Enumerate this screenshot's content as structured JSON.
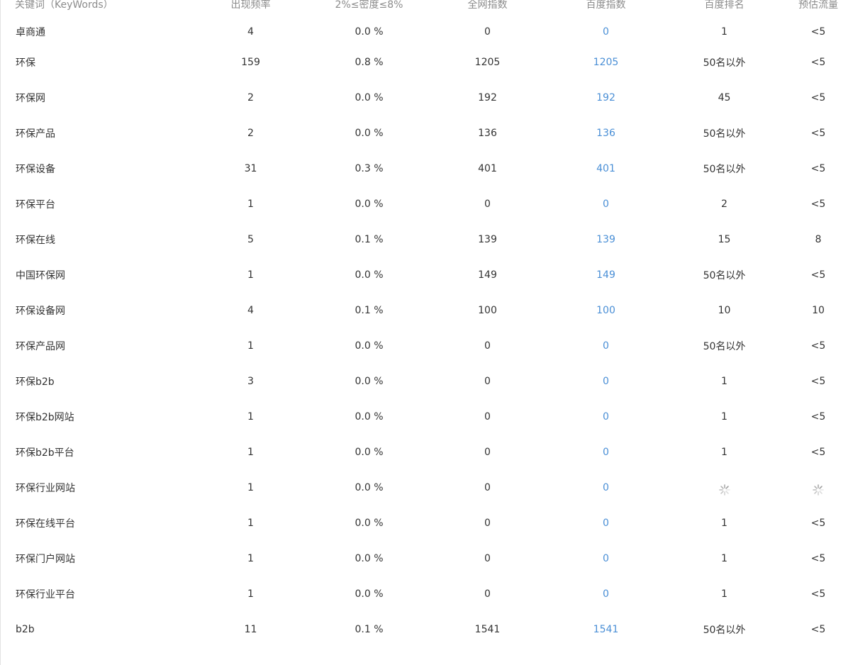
{
  "table": {
    "headers": {
      "keyword": "关键词（KeyWords）",
      "frequency": "出现频率",
      "density": "2%≤密度≤8%",
      "net_index": "全网指数",
      "baidu_index": "百度指数",
      "baidu_rank": "百度排名",
      "traffic": "预估流量"
    },
    "rows": [
      {
        "keyword": "卓商通",
        "frequency": "4",
        "density": "0.0 %",
        "net_index": "0",
        "baidu_index": "0",
        "baidu_rank": "1",
        "traffic": "<5"
      },
      {
        "keyword": "环保",
        "frequency": "159",
        "density": "0.8 %",
        "net_index": "1205",
        "baidu_index": "1205",
        "baidu_rank": "50名以外",
        "traffic": "<5"
      },
      {
        "keyword": "环保网",
        "frequency": "2",
        "density": "0.0 %",
        "net_index": "192",
        "baidu_index": "192",
        "baidu_rank": "45",
        "traffic": "<5"
      },
      {
        "keyword": "环保产品",
        "frequency": "2",
        "density": "0.0 %",
        "net_index": "136",
        "baidu_index": "136",
        "baidu_rank": "50名以外",
        "traffic": "<5"
      },
      {
        "keyword": "环保设备",
        "frequency": "31",
        "density": "0.3 %",
        "net_index": "401",
        "baidu_index": "401",
        "baidu_rank": "50名以外",
        "traffic": "<5"
      },
      {
        "keyword": "环保平台",
        "frequency": "1",
        "density": "0.0 %",
        "net_index": "0",
        "baidu_index": "0",
        "baidu_rank": "2",
        "traffic": "<5"
      },
      {
        "keyword": "环保在线",
        "frequency": "5",
        "density": "0.1 %",
        "net_index": "139",
        "baidu_index": "139",
        "baidu_rank": "15",
        "traffic": "8"
      },
      {
        "keyword": "中国环保网",
        "frequency": "1",
        "density": "0.0 %",
        "net_index": "149",
        "baidu_index": "149",
        "baidu_rank": "50名以外",
        "traffic": "<5"
      },
      {
        "keyword": "环保设备网",
        "frequency": "4",
        "density": "0.1 %",
        "net_index": "100",
        "baidu_index": "100",
        "baidu_rank": "10",
        "traffic": "10"
      },
      {
        "keyword": "环保产品网",
        "frequency": "1",
        "density": "0.0 %",
        "net_index": "0",
        "baidu_index": "0",
        "baidu_rank": "50名以外",
        "traffic": "<5"
      },
      {
        "keyword": "环保b2b",
        "frequency": "3",
        "density": "0.0 %",
        "net_index": "0",
        "baidu_index": "0",
        "baidu_rank": "1",
        "traffic": "<5"
      },
      {
        "keyword": "环保b2b网站",
        "frequency": "1",
        "density": "0.0 %",
        "net_index": "0",
        "baidu_index": "0",
        "baidu_rank": "1",
        "traffic": "<5"
      },
      {
        "keyword": "环保b2b平台",
        "frequency": "1",
        "density": "0.0 %",
        "net_index": "0",
        "baidu_index": "0",
        "baidu_rank": "1",
        "traffic": "<5"
      },
      {
        "keyword": "环保行业网站",
        "frequency": "1",
        "density": "0.0 %",
        "net_index": "0",
        "baidu_index": "0",
        "baidu_rank": "loading-spinner-icon",
        "traffic": "loading-spinner-icon"
      },
      {
        "keyword": "环保在线平台",
        "frequency": "1",
        "density": "0.0 %",
        "net_index": "0",
        "baidu_index": "0",
        "baidu_rank": "1",
        "traffic": "<5"
      },
      {
        "keyword": "环保门户网站",
        "frequency": "1",
        "density": "0.0 %",
        "net_index": "0",
        "baidu_index": "0",
        "baidu_rank": "1",
        "traffic": "<5"
      },
      {
        "keyword": "环保行业平台",
        "frequency": "1",
        "density": "0.0 %",
        "net_index": "0",
        "baidu_index": "0",
        "baidu_rank": "1",
        "traffic": "<5"
      },
      {
        "keyword": "b2b",
        "frequency": "11",
        "density": "0.1 %",
        "net_index": "1541",
        "baidu_index": "1541",
        "baidu_rank": "50名以外",
        "traffic": "<5"
      }
    ]
  },
  "colors": {
    "header_text": "#8c8c8c",
    "body_text": "#333333",
    "baidu_link": "#4a8fd6",
    "spinner": "#999999"
  }
}
